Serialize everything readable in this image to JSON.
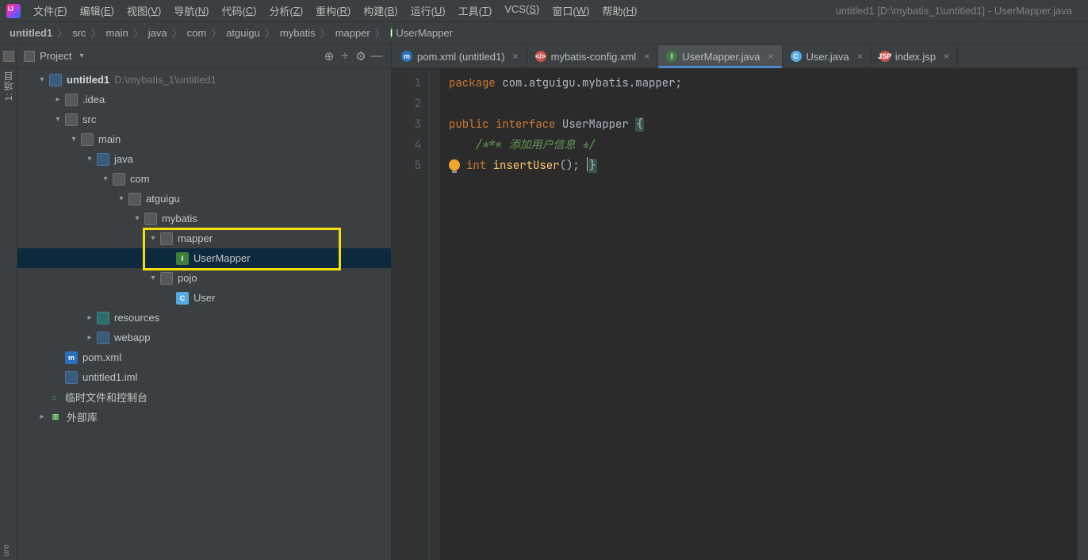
{
  "menus": [
    "文件(F)",
    "编辑(E)",
    "视图(V)",
    "导航(N)",
    "代码(C)",
    "分析(Z)",
    "重构(R)",
    "构建(B)",
    "运行(U)",
    "工具(T)",
    "VCS(S)",
    "窗口(W)",
    "帮助(H)"
  ],
  "window_title": "untitled1 [D:\\mybatis_1\\untitled1] - UserMapper.java",
  "breadcrumbs": [
    "untitled1",
    "src",
    "main",
    "java",
    "com",
    "atguigu",
    "mybatis",
    "mapper",
    "UserMapper"
  ],
  "breadcrumb_last_icon": "interface-icon",
  "sidebar": {
    "title": "Project",
    "tool_icons": [
      "target",
      "divide",
      "gear",
      "minimize"
    ]
  },
  "tree": {
    "project_name": "untitled1",
    "project_path": "D:\\mybatis_1\\untitled1",
    "idea": ".idea",
    "src": "src",
    "main": "main",
    "java": "java",
    "com": "com",
    "atguigu": "atguigu",
    "mybatis": "mybatis",
    "mapper": "mapper",
    "usermapper": "UserMapper",
    "pojo": "pojo",
    "user": "User",
    "resources": "resources",
    "webapp": "webapp",
    "pom": "pom.xml",
    "iml": "untitled1.iml",
    "scratches": "临时文件和控制台",
    "ext_lib": "外部库"
  },
  "tabs": [
    {
      "icon": "ti-m",
      "label": "pom.xml (untitled1)",
      "active": false
    },
    {
      "icon": "ti-x",
      "label": "mybatis-config.xml",
      "active": false
    },
    {
      "icon": "ti-i",
      "label": "UserMapper.java",
      "active": true
    },
    {
      "icon": "ti-c",
      "label": "User.java",
      "active": false
    },
    {
      "icon": "ti-j",
      "label": "index.jsp",
      "active": false
    }
  ],
  "editor": {
    "line_numbers": [
      "1",
      "2",
      "3",
      "4",
      "5"
    ],
    "l1_kw": "package",
    "l1_rest": " com.atguigu.mybatis.mapper;",
    "l3_kw1": "public",
    "l3_kw2": "interface",
    "l3_type": "UserMapper",
    "l3_brace": "{",
    "l4_cm": "/*** 添加用户信息 */",
    "l5_kw": "int",
    "l5_fn": "insertUser",
    "l5_tail": "();",
    "l5_end": "}"
  },
  "leftgutter": {
    "label": "1: 项目"
  },
  "bottomleft": "ure"
}
